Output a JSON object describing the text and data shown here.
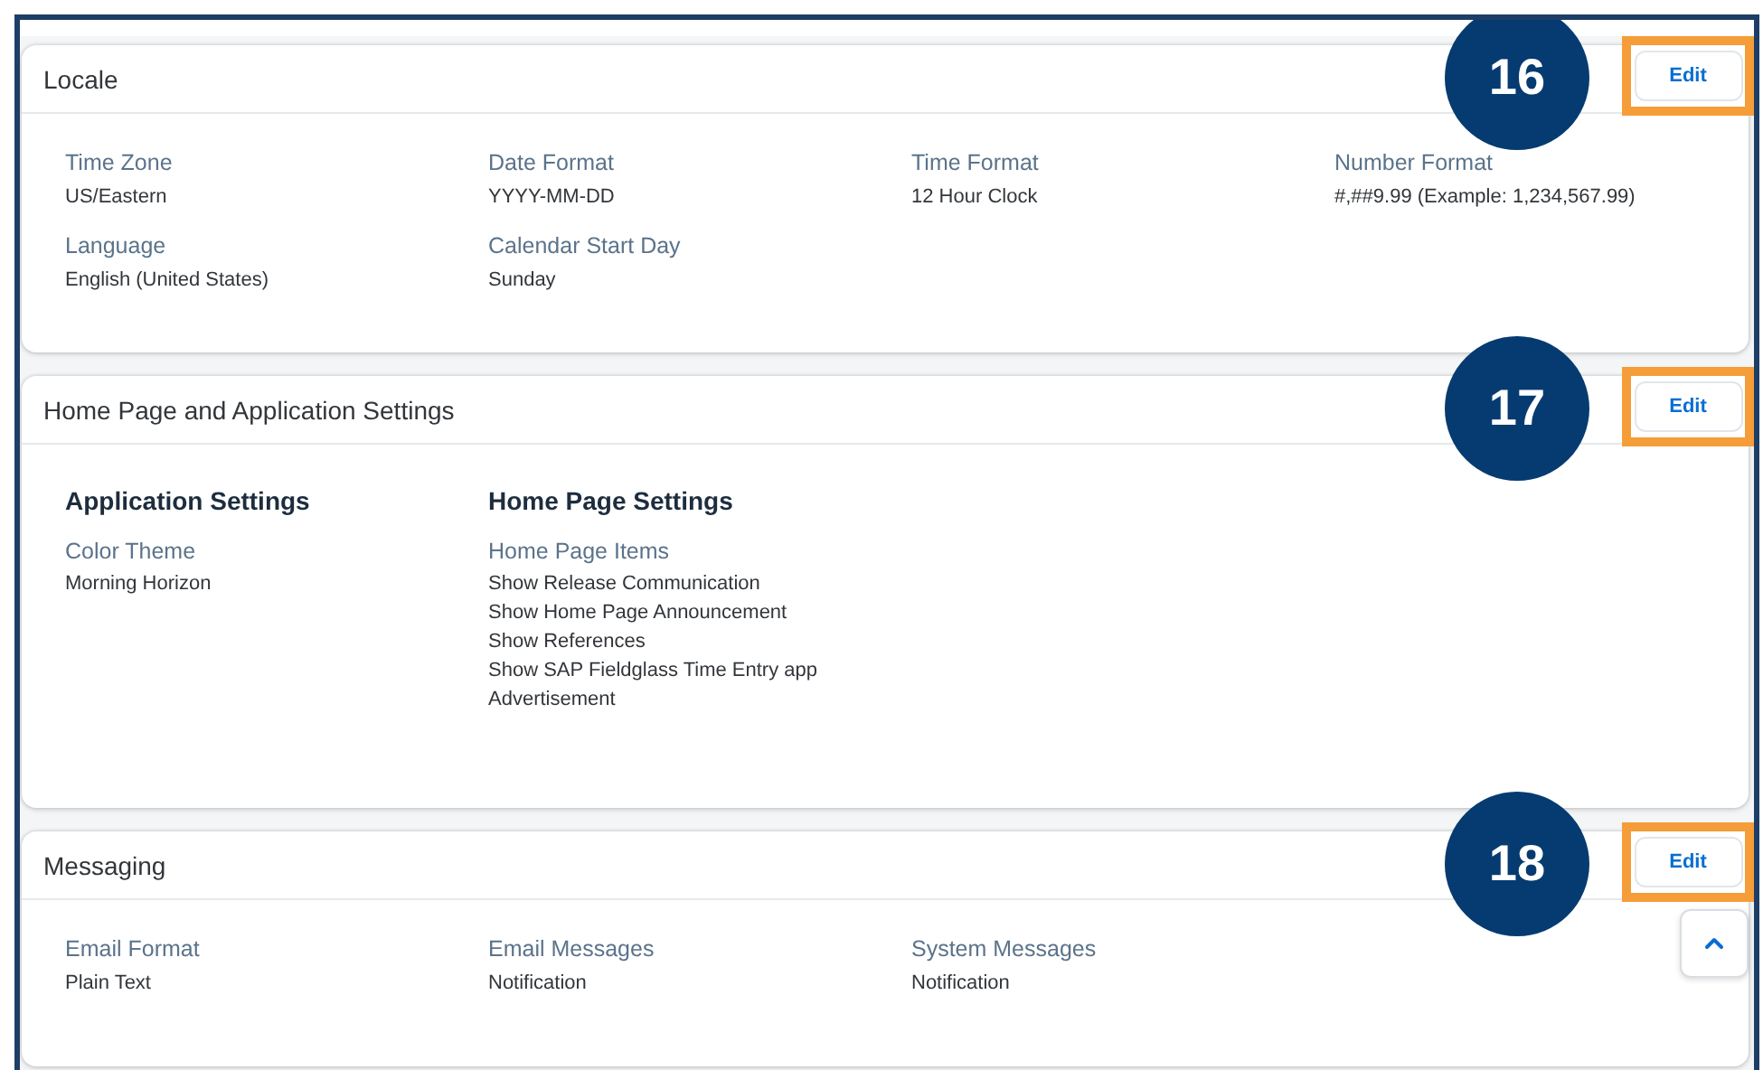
{
  "sections": [
    {
      "kind": "fields",
      "title": "Locale",
      "callout": "16",
      "edit_label": "Edit",
      "scroll_top": false,
      "fields": [
        {
          "label": "Time Zone",
          "value": "US/Eastern"
        },
        {
          "label": "Date Format",
          "value": "YYYY-MM-DD"
        },
        {
          "label": "Time Format",
          "value": "12 Hour Clock"
        },
        {
          "label": "Number Format",
          "value": "#,##9.99 (Example: 1,234,567.99)"
        },
        {
          "label": "Language",
          "value": "English (United States)"
        },
        {
          "label": "Calendar Start Day",
          "value": "Sunday"
        }
      ]
    },
    {
      "kind": "groups",
      "title": "Home Page and Application Settings",
      "callout": "17",
      "edit_label": "Edit",
      "scroll_top": false,
      "groups": [
        {
          "heading": "Application Settings",
          "label": "Color Theme",
          "values": [
            "Morning Horizon"
          ]
        },
        {
          "heading": "Home Page Settings",
          "label": "Home Page Items",
          "values": [
            "Show Release Communication",
            "Show Home Page Announcement",
            "Show References",
            "Show SAP Fieldglass Time Entry app",
            "Advertisement"
          ]
        }
      ]
    },
    {
      "kind": "fields",
      "title": "Messaging",
      "callout": "18",
      "edit_label": "Edit",
      "scroll_top": true,
      "fields": [
        {
          "label": "Email Format",
          "value": "Plain Text"
        },
        {
          "label": "Email Messages",
          "value": "Notification"
        },
        {
          "label": "System Messages",
          "value": "Notification"
        }
      ]
    }
  ]
}
